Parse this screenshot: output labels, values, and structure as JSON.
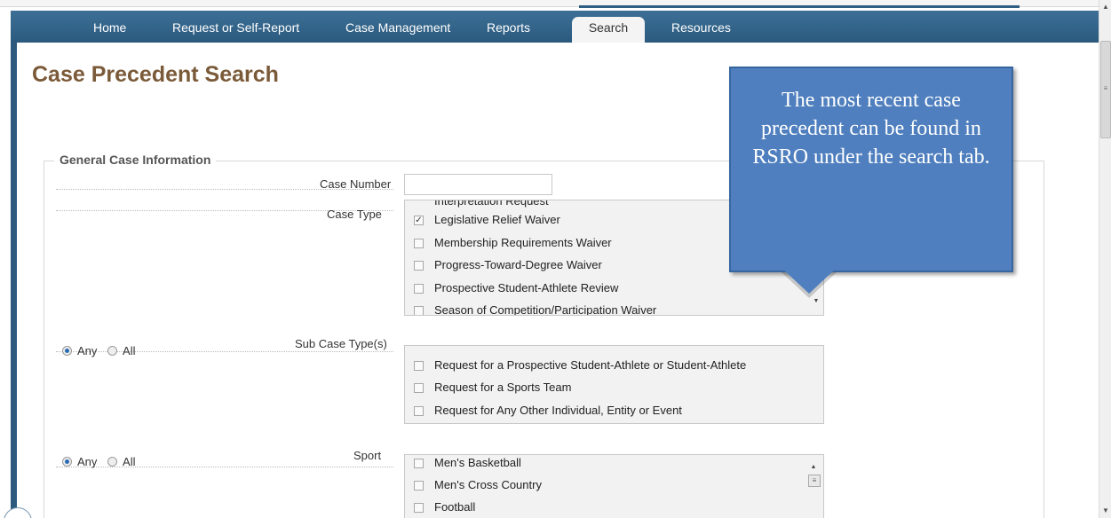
{
  "nav": {
    "items": [
      {
        "label": "Home",
        "active": false
      },
      {
        "label": "Request or Self-Report",
        "active": false
      },
      {
        "label": "Case Management",
        "active": false
      },
      {
        "label": "Reports",
        "active": false
      },
      {
        "label": "Search",
        "active": true
      },
      {
        "label": "Resources",
        "active": false
      }
    ]
  },
  "page": {
    "title": "Case Precedent Search"
  },
  "section": {
    "legend": "General Case Information"
  },
  "fields": {
    "case_number": {
      "label": "Case Number",
      "value": ""
    },
    "case_type": {
      "label": "Case Type",
      "options": [
        {
          "label": "Interpretation Request",
          "checked": false
        },
        {
          "label": "Legislative Relief Waiver",
          "checked": true
        },
        {
          "label": "Membership Requirements Waiver",
          "checked": false
        },
        {
          "label": "Progress-Toward-Degree Waiver",
          "checked": false
        },
        {
          "label": "Prospective Student-Athlete Review",
          "checked": false
        },
        {
          "label": "Season of Competition/Participation Waiver",
          "checked": false
        }
      ]
    },
    "sub_case_type": {
      "label": "Sub Case Type(s)",
      "match": {
        "any": "Any",
        "all": "All",
        "selected": "any"
      },
      "options": [
        {
          "label": "Request for a Prospective Student-Athlete or Student-Athlete",
          "checked": false
        },
        {
          "label": "Request for a Sports Team",
          "checked": false
        },
        {
          "label": "Request for Any Other Individual, Entity or Event",
          "checked": false
        }
      ]
    },
    "sport": {
      "label": "Sport",
      "match": {
        "any": "Any",
        "all": "All",
        "selected": "any"
      },
      "options": [
        {
          "label": "Men's Basketball",
          "checked": false
        },
        {
          "label": "Men's Cross Country",
          "checked": false
        },
        {
          "label": "Football",
          "checked": false
        }
      ]
    }
  },
  "callout": {
    "text": "The most recent case precedent can be found in RSRO under the search tab."
  },
  "colors": {
    "nav": "#2b5a7e",
    "title": "#7a5a38",
    "callout": "#4f7fbe"
  }
}
